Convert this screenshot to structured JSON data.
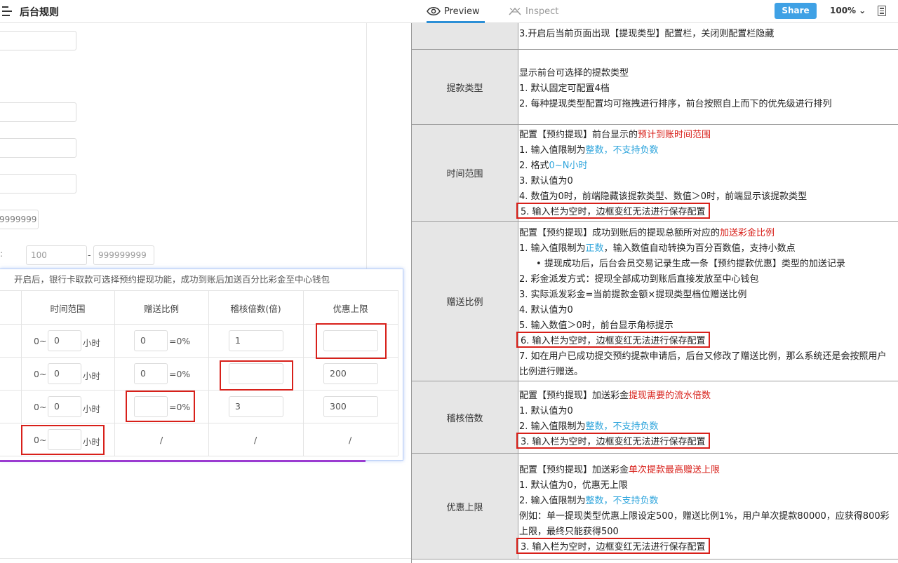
{
  "header": {
    "title": "后台规则",
    "tabs": [
      {
        "label": "Preview"
      },
      {
        "label": "Inspect"
      }
    ],
    "share_label": "Share",
    "zoom": "100%"
  },
  "left_form": {
    "range_min": "100",
    "range_sep": "-",
    "range_max": "999999999",
    "partial_max": "9999999"
  },
  "popup": {
    "description": "开启后，银行卡取款可选择预约提现功能，成功到账后加送百分比彩金至中心钱包",
    "columns": [
      "时间范围",
      "赠送比例",
      "稽核倍数(倍)",
      "优惠上限"
    ],
    "rows": [
      {
        "time_prefix": "0~",
        "time_value": "0",
        "time_unit": "小时",
        "ratio": "0",
        "ratio_suffix": "=0%",
        "audit": "1",
        "limit": ""
      },
      {
        "time_prefix": "0~",
        "time_value": "0",
        "time_unit": "小时",
        "ratio": "0",
        "ratio_suffix": "=0%",
        "audit": "",
        "limit": "200"
      },
      {
        "time_prefix": "0~",
        "time_value": "0",
        "time_unit": "小时",
        "ratio": "",
        "ratio_suffix": "=0%",
        "audit": "3",
        "limit": "300"
      },
      {
        "time_prefix": "0~",
        "time_value": "",
        "time_unit": "小时",
        "ratio_na": "/",
        "audit_na": "/",
        "limit_na": "/"
      }
    ]
  },
  "spec": {
    "top_line": "3.开启后当前页面出现【提现类型】配置栏，关闭则配置栏隐藏",
    "sections": [
      {
        "label": "提款类型",
        "lines": [
          "显示前台可选择的提款类型",
          "1. 默认固定可配置4档",
          "2. 每种提现类型配置均可拖拽进行排序，前台按照自上而下的优先级进行排列"
        ]
      },
      {
        "label": "时间范围",
        "lines": [
          {
            "a": "配置【预约提现】前台显示的",
            "b": "预计到账时间范围"
          },
          {
            "a": "1. 输入值限制为",
            "b": "整数，不支持负数"
          },
          {
            "a": "2. 格式",
            "b": "0~N小时"
          },
          "3. 默认值为0",
          "4. 数值为0时，前端隐藏该提款类型、数值＞0时，前端显示该提款类型",
          "5. 输入栏为空时，边框变红无法进行保存配置"
        ]
      },
      {
        "label": "赠送比例",
        "lines": [
          {
            "a": "配置【预约提现】成功到账后的提现总额所对应的",
            "b": "加送彩金比例"
          },
          {
            "a": "1. 输入值限制为",
            "b": "正数",
            "c": "，输入数值自动转换为百分百数值，支持小数点"
          },
          "提现成功后，后台会员交易记录生成一条【预约提款优惠】类型的加送记录",
          "2. 彩金派发方式：提现全部成功到账后直接发放至中心钱包",
          "3. 实际派发彩金=当前提款金额×提现类型档位赠送比例",
          "4. 默认值为0",
          "5. 输入数值＞0时，前台显示角标提示",
          "6. 输入栏为空时，边框变红无法进行保存配置",
          "7. 如在用户已成功提交预约提款申请后，后台又修改了赠送比例，那么系统还是会按照用户",
          "比例进行赠送。"
        ]
      },
      {
        "label": "稽核倍数",
        "lines": [
          {
            "a": "配置【预约提现】加送彩金",
            "b": "提现需要的流水倍数"
          },
          "1. 默认值为0",
          {
            "a": "2. 输入值限制为",
            "b": "整数，不支持负数"
          },
          "3. 输入栏为空时，边框变红无法进行保存配置"
        ]
      },
      {
        "label": "优惠上限",
        "lines": [
          {
            "a": "配置【预约提现】加送彩金",
            "b": "单次提款最高赠送上限"
          },
          "1. 默认值为0，优惠无上限",
          {
            "a": "2. 输入值限制为",
            "b": "整数，不支持负数"
          },
          "例如：单一提现类型优惠上限设定500，赠送比例1%，用户单次提款80000，应获得800彩",
          "上限，最终只能获得500",
          "3. 输入栏为空时，边框变红无法进行保存配置"
        ]
      }
    ]
  },
  "colors": {
    "accent": "#3fa1e5",
    "highlight_red": "#d8201a",
    "highlight_blue": "#2fa5dc",
    "label_bg": "#e6e6e6"
  }
}
